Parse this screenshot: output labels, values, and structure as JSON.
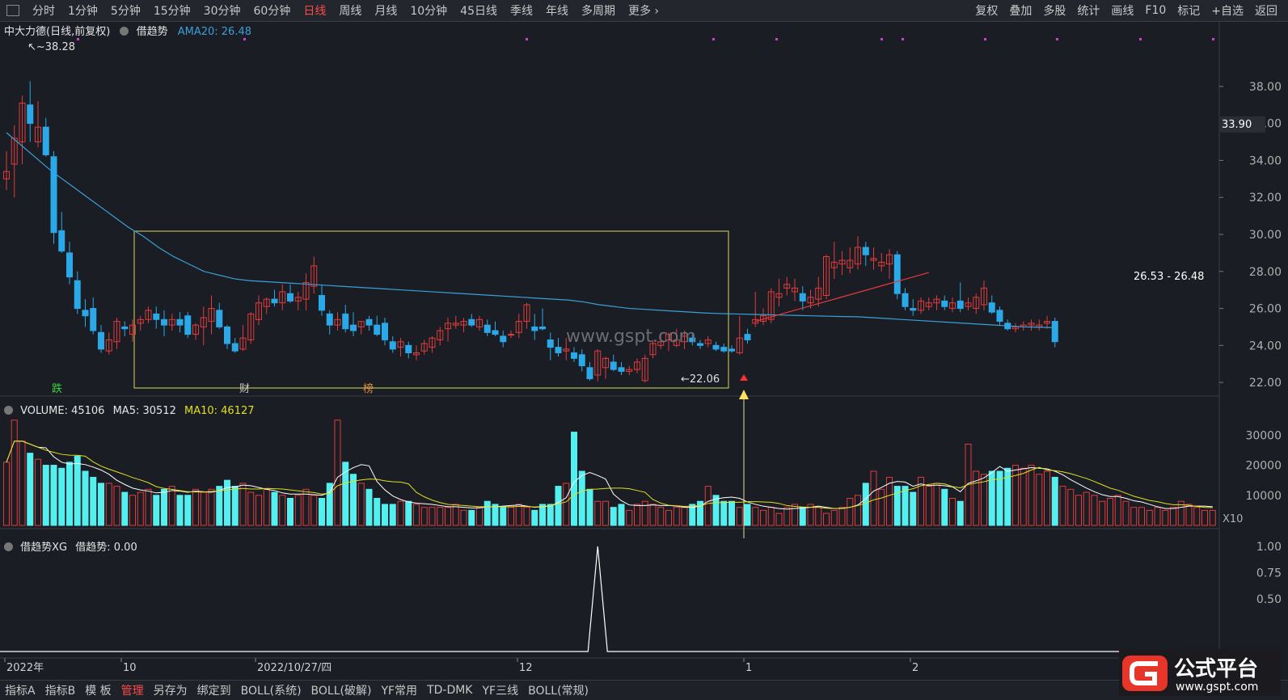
{
  "toolbar": {
    "timeframes": [
      "分时",
      "1分钟",
      "5分钟",
      "15分钟",
      "30分钟",
      "60分钟",
      "日线",
      "周线",
      "月线",
      "10分钟",
      "45日线",
      "季线",
      "年线",
      "多周期",
      "更多"
    ],
    "active": "日线",
    "right": [
      "复权",
      "叠加",
      "多股",
      "统计",
      "画线",
      "F10",
      "标记",
      "+自选",
      "返回"
    ]
  },
  "main_panel": {
    "stock": "中大力德(日线,前复权)",
    "indicator": "借趋势",
    "ama": "AMA20: 26.48",
    "high_label": "38.28",
    "low_label": "22.06",
    "current_price": "33.90",
    "range_label": "26.53 - 26.48",
    "markers": [
      "跌",
      "财",
      "榜"
    ],
    "watermark": "www.gspt.com",
    "price_ticks": [
      "38.00",
      "36.00",
      "34.00",
      "32.00",
      "30.00",
      "28.00",
      "26.00",
      "24.00",
      "22.00"
    ]
  },
  "volume_panel": {
    "title": "VOLUME: 45106",
    "ma5": "MA5: 30512",
    "ma10": "MA10: 46127",
    "ticks": [
      "30000",
      "20000",
      "10000"
    ],
    "unit": "X10"
  },
  "xg_panel": {
    "title": "借趋势XG",
    "value": "借趋势: 0.00",
    "ticks": [
      "1.00",
      "0.75",
      "0.50"
    ]
  },
  "x_axis": {
    "labels": [
      "2022年",
      "10",
      "2022/10/27/四",
      "12",
      "1",
      "2"
    ]
  },
  "bottom_tabs": [
    "指标A",
    "指标B",
    "模 板",
    "管理",
    "另存为",
    "绑定到",
    "BOLL(系统)",
    "BOLL(破解)",
    "YF常用",
    "TD-DMK",
    "YF三线",
    "BOLL(常规)"
  ],
  "bottom_active": "管理",
  "logo": {
    "brand": "公式平台",
    "url": "www.gspt.com"
  },
  "colors": {
    "up": "#e23b3b",
    "down": "#2aa8e8",
    "vol_down": "#54f0f0",
    "ama": "#3aa0d8",
    "ma10": "#e0e020",
    "ma5": "#ffffff",
    "box": "#d8d860"
  },
  "chart_data": {
    "type": "candlestick",
    "ylim": [
      21,
      39
    ],
    "candles": [
      [
        33,
        34.5,
        32.4,
        33.4
      ],
      [
        33.8,
        35.9,
        32,
        35.2
      ],
      [
        35,
        37.5,
        33.8,
        37.1
      ],
      [
        37,
        38.28,
        35,
        36
      ],
      [
        35,
        37.2,
        34.7,
        35.8
      ],
      [
        35.8,
        36.3,
        34.2,
        34.3
      ],
      [
        34.2,
        34.5,
        29.5,
        30.1
      ],
      [
        30.2,
        31.2,
        29,
        29.1
      ],
      [
        29,
        29.6,
        27.3,
        27.7
      ],
      [
        27.5,
        28,
        25.7,
        26
      ],
      [
        25.9,
        26.5,
        25,
        25.6
      ],
      [
        26,
        26.6,
        24.6,
        24.8
      ],
      [
        24.7,
        25.1,
        23.6,
        23.8
      ],
      [
        23.7,
        24.7,
        23.5,
        24.3
      ],
      [
        24.2,
        25.5,
        23.8,
        25.3
      ],
      [
        25,
        25.3,
        24.5,
        24.9
      ],
      [
        24.6,
        25.4,
        24.2,
        25.1
      ],
      [
        25.2,
        25.6,
        24.8,
        25.4
      ],
      [
        25.4,
        26.1,
        25.2,
        25.9
      ],
      [
        25.7,
        26.1,
        24.9,
        25.4
      ],
      [
        25.4,
        25.9,
        24.5,
        25.1
      ],
      [
        25.1,
        25.7,
        24.8,
        25.4
      ],
      [
        25.4,
        25.8,
        24.7,
        25.1
      ],
      [
        25.6,
        25.8,
        24.4,
        24.6
      ],
      [
        24.6,
        25.2,
        24.3,
        25.1
      ],
      [
        25,
        26.1,
        24,
        25.5
      ],
      [
        25.3,
        26.7,
        24.6,
        26
      ],
      [
        25.9,
        26.3,
        24.9,
        25
      ],
      [
        25,
        25.1,
        23.8,
        24.1
      ],
      [
        24.1,
        24.4,
        23.6,
        23.7
      ],
      [
        23.8,
        25.1,
        23.7,
        24.4
      ],
      [
        24.3,
        25.8,
        24.1,
        25.7
      ],
      [
        25.4,
        26.7,
        25.1,
        26.3
      ],
      [
        26.1,
        26.6,
        25.7,
        26.5
      ],
      [
        26.5,
        27,
        26.1,
        26.3
      ],
      [
        26.3,
        27.3,
        25.9,
        26.9
      ],
      [
        26.8,
        27.3,
        26.3,
        26.4
      ],
      [
        26.4,
        26.9,
        25.9,
        26.6
      ],
      [
        26.5,
        27.9,
        25.9,
        27.4
      ],
      [
        27.2,
        28.8,
        26.8,
        28.3
      ],
      [
        26.7,
        27.3,
        25.6,
        25.9
      ],
      [
        25.7,
        25.9,
        24.6,
        25.1
      ],
      [
        25.1,
        25.8,
        24.8,
        25.4
      ],
      [
        25.7,
        26.2,
        24.7,
        24.9
      ],
      [
        25.1,
        25.8,
        24.5,
        24.8
      ],
      [
        25,
        25.3,
        24.6,
        25.3
      ],
      [
        25.4,
        25.6,
        24.8,
        25.1
      ],
      [
        25.1,
        25.6,
        24.5,
        24.6
      ],
      [
        25.2,
        25.5,
        24,
        24.3
      ],
      [
        24.2,
        24.5,
        23.6,
        23.8
      ],
      [
        23.9,
        24.4,
        23.4,
        24.2
      ],
      [
        24,
        24.2,
        23.3,
        23.6
      ],
      [
        23.5,
        24,
        23.2,
        23.6
      ],
      [
        23.7,
        24.3,
        23.5,
        24.1
      ],
      [
        23.9,
        24.5,
        23.6,
        24.4
      ],
      [
        24.3,
        25,
        24,
        24.8
      ],
      [
        24.9,
        25.5,
        24.2,
        25.2
      ],
      [
        25.1,
        25.6,
        24.9,
        25.2
      ],
      [
        25.1,
        25.5,
        24.7,
        25.3
      ],
      [
        25.4,
        25.7,
        25,
        25.1
      ],
      [
        25,
        25.6,
        24.8,
        25.4
      ],
      [
        25.1,
        25.4,
        24.5,
        24.7
      ],
      [
        24.8,
        25.3,
        24.5,
        24.6
      ],
      [
        24.5,
        24.8,
        23.9,
        24.2
      ],
      [
        24.6,
        24.8,
        24.4,
        24.6
      ],
      [
        24.7,
        25.7,
        24.4,
        25.3
      ],
      [
        25.3,
        26.3,
        24.9,
        26.2
      ],
      [
        25,
        25.7,
        24.3,
        24.8
      ],
      [
        25,
        26,
        24.8,
        24.9
      ],
      [
        24.3,
        24.7,
        23.2,
        23.9
      ],
      [
        23.9,
        24.4,
        23.4,
        23.6
      ],
      [
        23.7,
        24.4,
        23.2,
        23.8
      ],
      [
        23.6,
        23.9,
        23.1,
        23.3
      ],
      [
        23.5,
        23.8,
        22.6,
        22.9
      ],
      [
        22.8,
        23.1,
        22.1,
        22.2
      ],
      [
        22.4,
        23.8,
        22.06,
        23.7
      ],
      [
        22.8,
        23.4,
        22.2,
        23.3
      ],
      [
        23.1,
        23.5,
        22.6,
        22.7
      ],
      [
        22.8,
        23.1,
        22.4,
        22.6
      ],
      [
        22.6,
        22.9,
        22.4,
        22.7
      ],
      [
        22.7,
        23.3,
        22.5,
        23.1
      ],
      [
        22.1,
        23.5,
        22,
        23.3
      ],
      [
        23.5,
        24.3,
        23.3,
        24.1
      ],
      [
        24,
        24.7,
        23.8,
        24.2
      ],
      [
        24.3,
        24.7,
        23.7,
        24.6
      ],
      [
        24,
        24.9,
        23.9,
        24.3
      ],
      [
        24.2,
        24.8,
        23.8,
        24.5
      ],
      [
        24.4,
        24.6,
        24,
        24.2
      ],
      [
        24.1,
        24.3,
        23.8,
        24
      ],
      [
        24.1,
        24.5,
        23.9,
        24.3
      ],
      [
        24,
        24.2,
        23.7,
        23.8
      ],
      [
        23.9,
        24.1,
        23.6,
        23.7
      ],
      [
        23.8,
        24,
        23.6,
        23.7
      ],
      [
        23.6,
        25.6,
        23.5,
        24.4
      ],
      [
        24.6,
        24.9,
        24.1,
        24.3
      ],
      [
        25.2,
        26.9,
        25,
        25.4
      ],
      [
        25.3,
        26,
        25.1,
        25.6
      ],
      [
        25.4,
        27.1,
        25.2,
        26.9
      ],
      [
        26.6,
        27.6,
        26.1,
        26.8
      ],
      [
        27.1,
        27.7,
        26.7,
        27.3
      ],
      [
        26.9,
        27.6,
        26.4,
        27.1
      ],
      [
        26.8,
        27.2,
        25.9,
        26.4
      ],
      [
        26.3,
        27,
        26,
        26.6
      ],
      [
        26.5,
        27.7,
        26.1,
        27.1
      ],
      [
        26.7,
        28.9,
        26.5,
        28.8
      ],
      [
        28.2,
        29.6,
        27.6,
        28.5
      ],
      [
        28.4,
        29.1,
        27.8,
        28.6
      ],
      [
        28.2,
        29.3,
        27.9,
        28.6
      ],
      [
        28.4,
        29.9,
        28.1,
        29.3
      ],
      [
        29.3,
        29.6,
        28.3,
        28.9
      ],
      [
        28.6,
        29.3,
        28.1,
        28.7
      ],
      [
        28.3,
        29,
        28,
        28.5
      ],
      [
        28.4,
        29.2,
        27.6,
        28.9
      ],
      [
        28.9,
        29.1,
        26.5,
        26.8
      ],
      [
        26.8,
        27.1,
        25.9,
        26.1
      ],
      [
        26,
        26.5,
        25.6,
        25.9
      ],
      [
        25.9,
        26.6,
        25.7,
        26.4
      ],
      [
        26.1,
        26.6,
        25.9,
        26.3
      ],
      [
        26.3,
        26.7,
        25.9,
        26.5
      ],
      [
        26.4,
        26.7,
        25.9,
        26.1
      ],
      [
        26,
        26.6,
        25.8,
        26.3
      ],
      [
        26.4,
        27.4,
        25.8,
        26
      ],
      [
        26.1,
        26.6,
        25.9,
        26.3
      ],
      [
        26,
        26.8,
        25.7,
        26.6
      ],
      [
        26.2,
        27.5,
        25.9,
        27.1
      ],
      [
        26.3,
        26.7,
        25.7,
        25.8
      ],
      [
        25.9,
        26.1,
        25.1,
        25.3
      ],
      [
        25.2,
        25.4,
        24.8,
        24.9
      ],
      [
        24.9,
        25.2,
        24.7,
        25
      ],
      [
        25,
        25.3,
        24.8,
        25.1
      ],
      [
        25.1,
        25.4,
        24.8,
        25.2
      ],
      [
        25,
        25.4,
        24.8,
        25.1
      ],
      [
        25.2,
        25.6,
        24.9,
        25.3
      ],
      [
        25.3,
        25.5,
        23.9,
        24.2
      ]
    ],
    "ama": [
      35.5,
      34.8,
      34.1,
      33.4,
      32.8,
      32.2,
      31.6,
      31,
      30.4,
      29.9,
      29.3,
      28.8,
      28.4,
      28,
      27.8,
      27.6,
      27.5,
      27.45,
      27.4,
      27.35,
      27.3,
      27.25,
      27.2,
      27.15,
      27.1,
      27.05,
      27,
      26.95,
      26.9,
      26.85,
      26.8,
      26.75,
      26.7,
      26.65,
      26.6,
      26.55,
      26.5,
      26.45,
      26.35,
      26.2,
      26.1,
      26,
      25.95,
      25.9,
      25.85,
      25.8,
      25.75,
      25.72,
      25.7,
      25.68,
      25.66,
      25.64,
      25.62,
      25.6,
      25.58,
      25.56,
      25.55,
      25.5,
      25.45,
      25.4,
      25.35,
      25.3,
      25.25,
      25.2,
      25.15,
      25.1,
      25.05,
      25,
      24.98,
      24.96
    ],
    "volume": [
      21,
      35,
      28,
      24,
      22,
      20,
      20,
      19,
      21,
      23,
      18,
      16,
      14,
      14,
      13,
      11,
      10,
      11,
      12,
      10,
      12,
      13,
      10,
      10,
      12,
      11,
      12,
      13,
      15,
      13,
      14,
      11,
      10,
      12,
      11,
      10,
      9,
      10,
      12,
      10,
      9,
      14,
      35,
      21,
      17,
      14,
      12,
      9,
      7,
      7,
      8,
      8,
      7,
      6,
      6,
      6,
      6,
      7,
      5,
      5,
      6,
      8,
      7,
      6,
      6,
      7,
      6,
      5,
      7,
      7,
      13,
      14,
      31,
      18,
      12,
      8,
      8,
      6,
      7,
      5,
      7,
      8,
      7,
      6,
      5,
      6,
      6,
      7,
      8,
      13,
      10,
      8,
      8,
      6,
      7,
      6,
      5,
      6,
      4,
      6,
      7,
      6,
      7,
      6,
      4,
      5,
      6,
      9,
      10,
      14,
      18,
      12,
      16,
      13,
      13,
      11,
      16,
      13,
      14,
      12,
      9,
      8,
      27,
      18,
      17,
      18,
      18,
      19,
      20,
      19,
      20,
      17,
      18,
      16,
      13,
      12,
      10,
      11,
      10,
      8,
      9,
      10,
      8,
      6,
      6,
      5,
      6,
      5,
      6,
      8,
      7,
      6,
      5,
      5
    ],
    "xg_peak_index": 75
  }
}
